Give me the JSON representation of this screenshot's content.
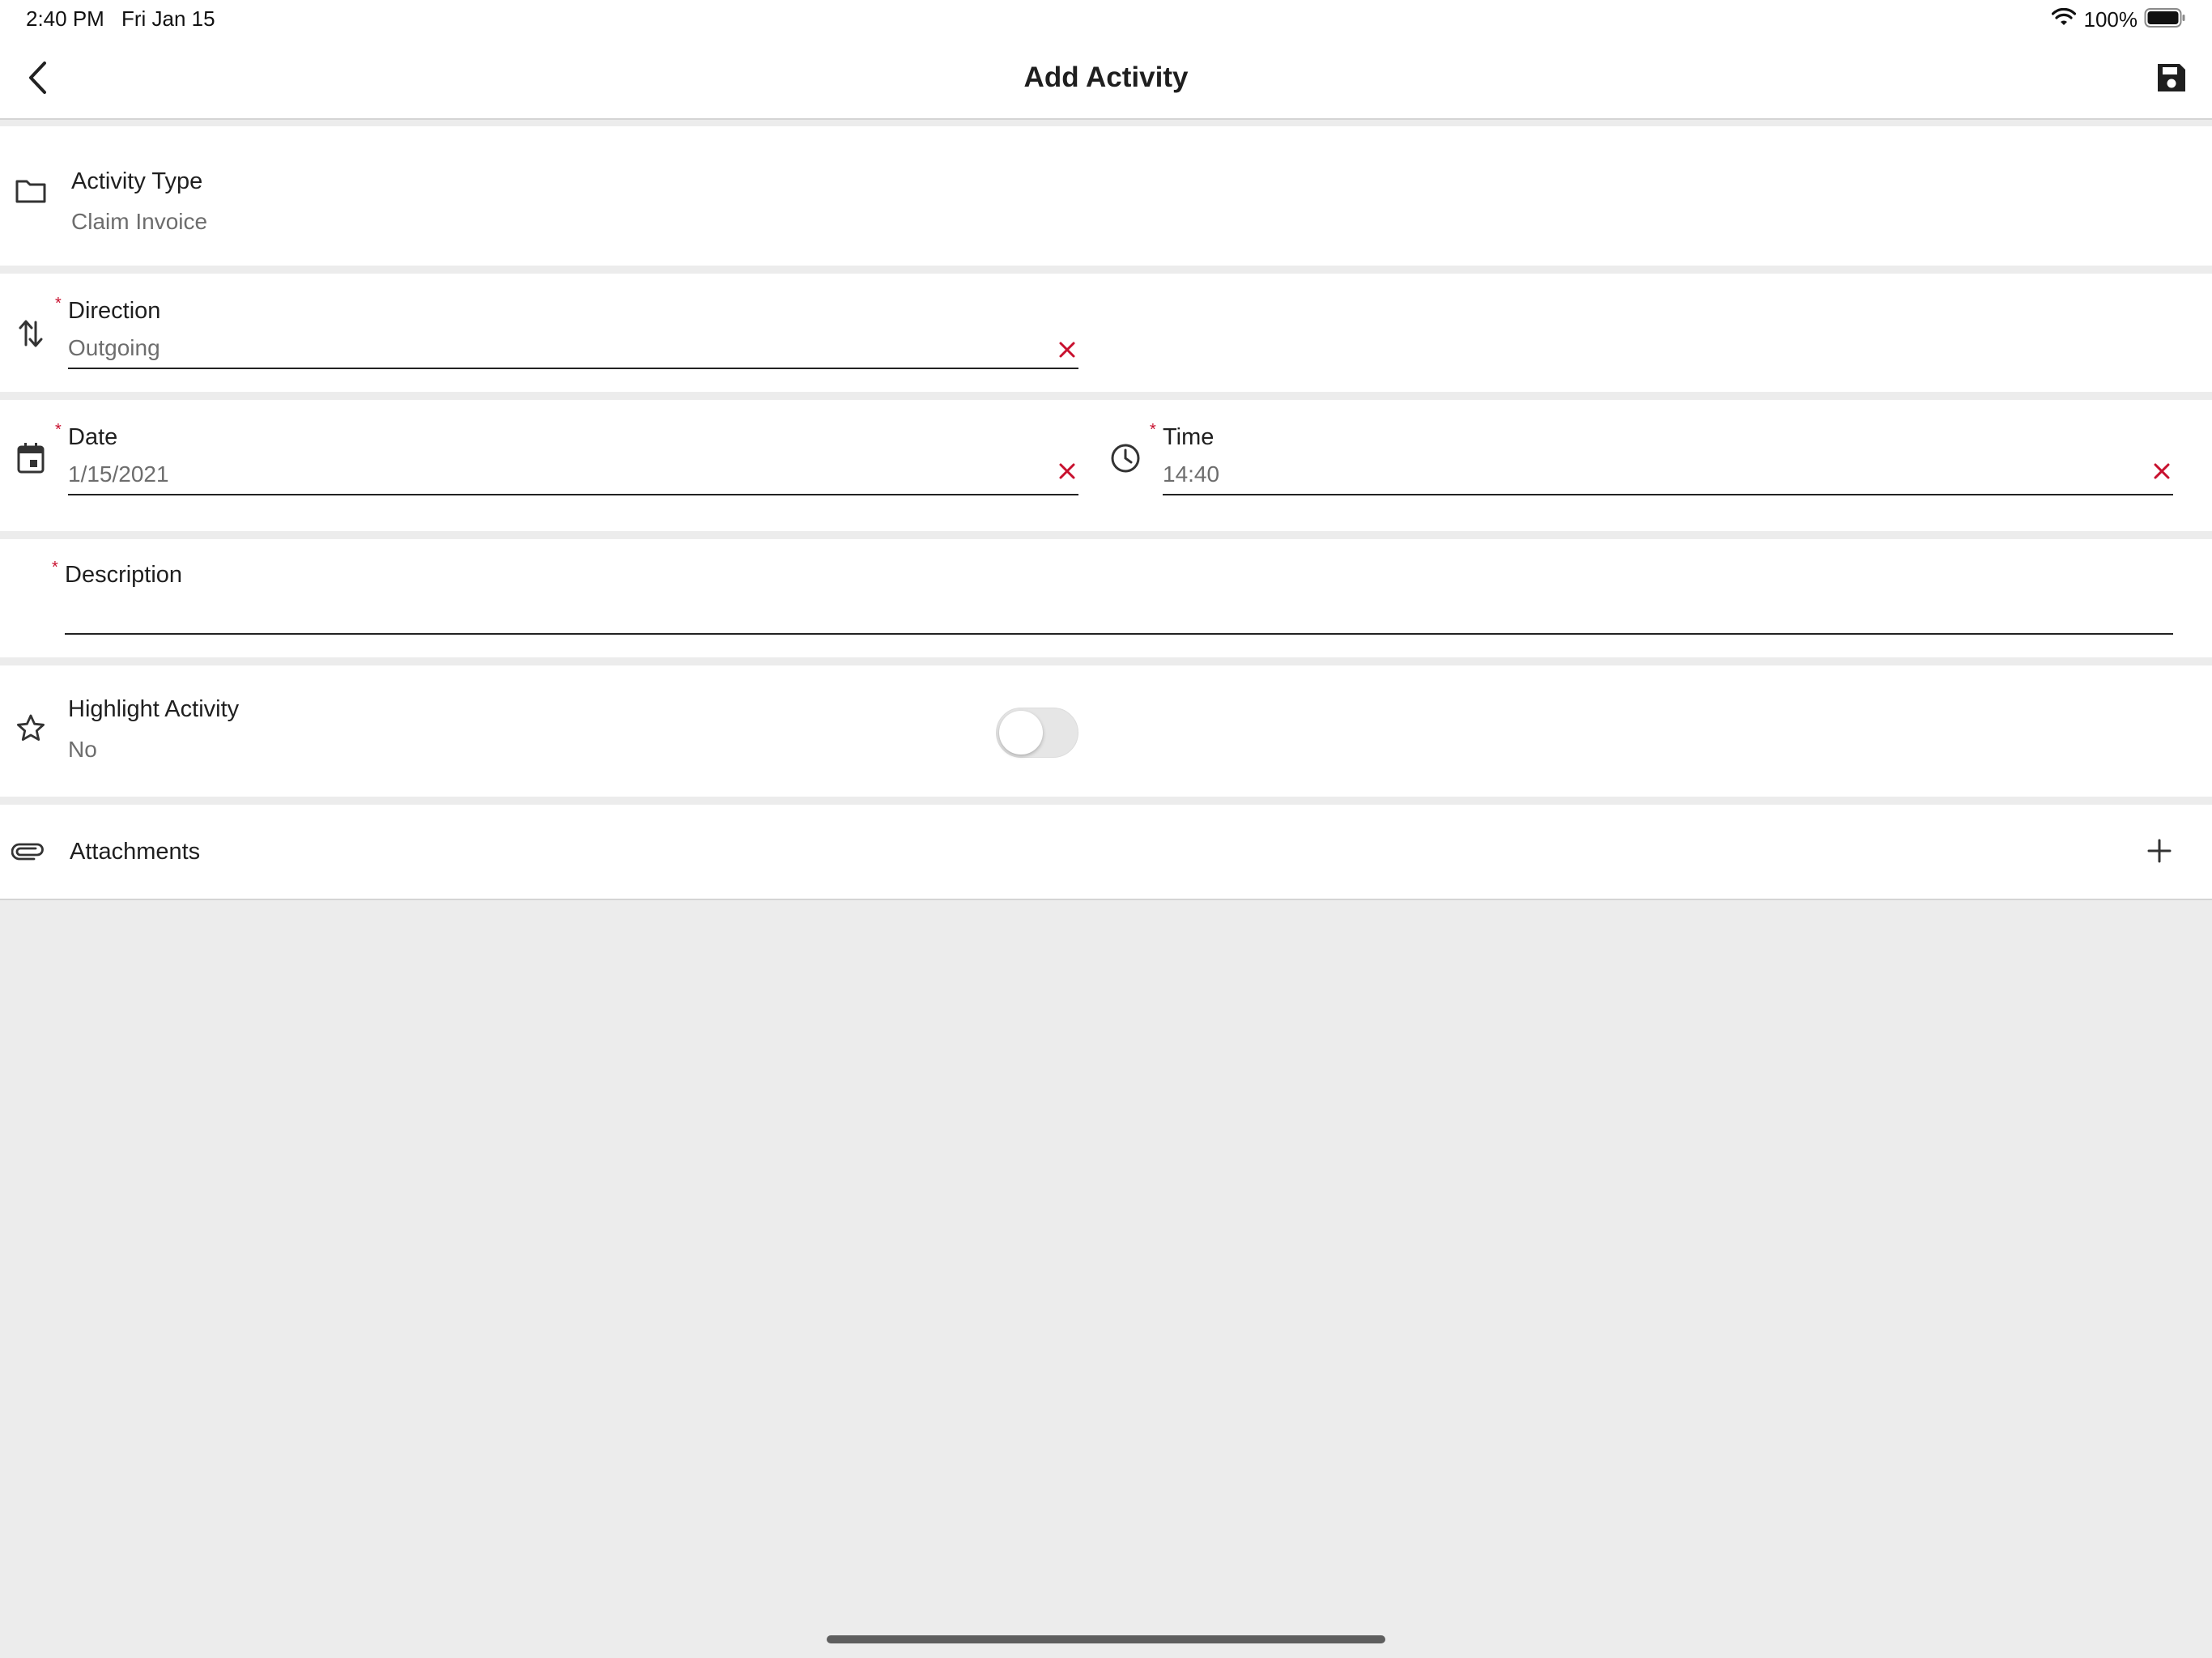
{
  "status_bar": {
    "time": "2:40 PM",
    "date": "Fri Jan 15",
    "battery": "100%",
    "icons": [
      "wifi-icon",
      "battery-icon"
    ]
  },
  "nav": {
    "title": "Add Activity",
    "icons": [
      "chevron-left-icon",
      "floppy-disk-icon"
    ]
  },
  "activity_type": {
    "label": "Activity Type",
    "value": "Claim Invoice",
    "icon": "folder-icon"
  },
  "direction": {
    "label": "Direction",
    "value": "Outgoing",
    "required_mark": "*",
    "icon": "swap-vertical-icon"
  },
  "date": {
    "label": "Date",
    "value": "1/15/2021",
    "required_mark": "*",
    "icon": "calendar-icon"
  },
  "time": {
    "label": "Time",
    "value": "14:40",
    "required_mark": "*",
    "icon": "clock-icon"
  },
  "description": {
    "label": "Description",
    "value": "",
    "required_mark": "*"
  },
  "highlight": {
    "label": "Highlight Activity",
    "value": "No",
    "enabled": false,
    "icon": "star-outline-icon"
  },
  "attachments": {
    "label": "Attachments",
    "icon": "paperclip-icon"
  },
  "colors": {
    "accent_red": "#c8102e",
    "background": "#ececec",
    "surface": "#ffffff"
  }
}
